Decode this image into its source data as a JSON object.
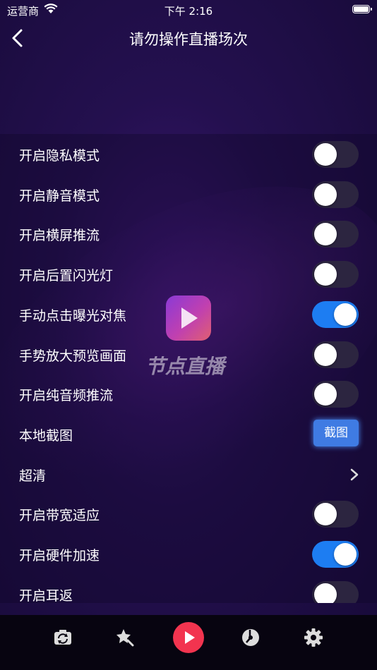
{
  "status_bar": {
    "carrier": "运营商",
    "time": "下午 2:16"
  },
  "nav": {
    "title": "请勿操作直播场次"
  },
  "settings": [
    {
      "label": "开启隐私模式",
      "control": "toggle",
      "on": false
    },
    {
      "label": "开启静音模式",
      "control": "toggle",
      "on": false
    },
    {
      "label": "开启横屏推流",
      "control": "toggle",
      "on": false
    },
    {
      "label": "开启后置闪光灯",
      "control": "toggle",
      "on": false
    },
    {
      "label": "手动点击曝光对焦",
      "control": "toggle",
      "on": true
    },
    {
      "label": "手势放大预览画面",
      "control": "toggle",
      "on": false
    },
    {
      "label": "开启纯音频推流",
      "control": "toggle",
      "on": false
    },
    {
      "label": "本地截图",
      "control": "button",
      "button_label": "截图"
    },
    {
      "label": "超清",
      "control": "chevron"
    },
    {
      "label": "开启带宽适应",
      "control": "toggle",
      "on": false
    },
    {
      "label": "开启硬件加速",
      "control": "toggle",
      "on": true
    },
    {
      "label": "开启耳返",
      "control": "toggle",
      "on": false
    }
  ],
  "watermark": {
    "text": "节点直播"
  },
  "tabbar": {
    "icons": [
      "camera-switch-icon",
      "magic-beauty-icon",
      "record-play-icon",
      "music-disc-icon",
      "settings-gear-icon"
    ],
    "accent_color": "#f2344f"
  },
  "colors": {
    "toggle_on": "#1d7df2",
    "toggle_off": "#2c2540",
    "button": "#3f7be3"
  }
}
